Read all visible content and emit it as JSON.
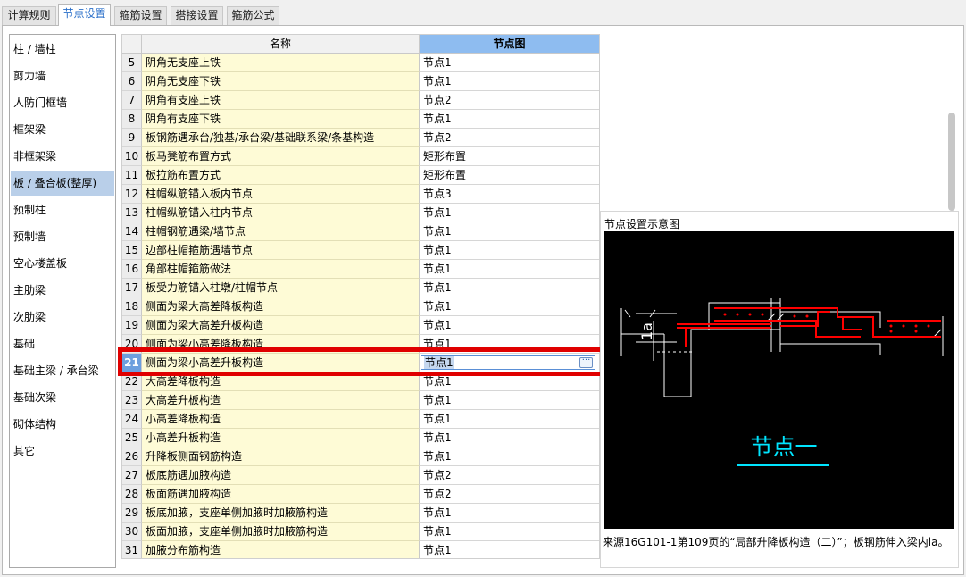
{
  "tabs": [
    {
      "label": "计算规则"
    },
    {
      "label": "节点设置"
    },
    {
      "label": "箍筋设置"
    },
    {
      "label": "搭接设置"
    },
    {
      "label": "箍筋公式"
    }
  ],
  "sidebar": {
    "items": [
      {
        "label": "柱 / 墙柱"
      },
      {
        "label": "剪力墙"
      },
      {
        "label": "人防门框墙"
      },
      {
        "label": "框架梁"
      },
      {
        "label": "非框架梁"
      },
      {
        "label": "板 / 叠合板(整厚)"
      },
      {
        "label": "预制柱"
      },
      {
        "label": "预制墙"
      },
      {
        "label": "空心楼盖板"
      },
      {
        "label": "主肋梁"
      },
      {
        "label": "次肋梁"
      },
      {
        "label": "基础"
      },
      {
        "label": "基础主梁 / 承台梁"
      },
      {
        "label": "基础次梁"
      },
      {
        "label": "砌体结构"
      },
      {
        "label": "其它"
      }
    ]
  },
  "grid": {
    "headers": {
      "name": "名称",
      "value": "节点图"
    },
    "rows": [
      {
        "num": "5",
        "name": "阴角无支座上铁",
        "value": "节点1"
      },
      {
        "num": "6",
        "name": "阴角无支座下铁",
        "value": "节点1"
      },
      {
        "num": "7",
        "name": "阴角有支座上铁",
        "value": "节点2"
      },
      {
        "num": "8",
        "name": "阴角有支座下铁",
        "value": "节点1"
      },
      {
        "num": "9",
        "name": "板钢筋遇承台/独基/承台梁/基础联系梁/条基构造",
        "value": "节点2"
      },
      {
        "num": "10",
        "name": "板马凳筋布置方式",
        "value": "矩形布置"
      },
      {
        "num": "11",
        "name": "板拉筋布置方式",
        "value": "矩形布置"
      },
      {
        "num": "12",
        "name": "柱帽纵筋锚入板内节点",
        "value": "节点3"
      },
      {
        "num": "13",
        "name": "柱帽纵筋锚入柱内节点",
        "value": "节点1"
      },
      {
        "num": "14",
        "name": "柱帽钢筋遇梁/墙节点",
        "value": "节点1"
      },
      {
        "num": "15",
        "name": "边部柱帽箍筋遇墙节点",
        "value": "节点1"
      },
      {
        "num": "16",
        "name": "角部柱帽箍筋做法",
        "value": "节点1"
      },
      {
        "num": "17",
        "name": "板受力筋锚入柱墩/柱帽节点",
        "value": "节点1"
      },
      {
        "num": "18",
        "name": "侧面为梁大高差降板构造",
        "value": "节点1"
      },
      {
        "num": "19",
        "name": "侧面为梁大高差升板构造",
        "value": "节点1"
      },
      {
        "num": "20",
        "name": "侧面为梁小高差降板构造",
        "value": "节点1"
      },
      {
        "num": "21",
        "name": "侧面为梁小高差升板构造",
        "value": "节点1"
      },
      {
        "num": "22",
        "name": "大高差降板构造",
        "value": "节点1"
      },
      {
        "num": "23",
        "name": "大高差升板构造",
        "value": "节点1"
      },
      {
        "num": "24",
        "name": "小高差降板构造",
        "value": "节点1"
      },
      {
        "num": "25",
        "name": "小高差升板构造",
        "value": "节点1"
      },
      {
        "num": "26",
        "name": "升降板侧面钢筋构造",
        "value": "节点1"
      },
      {
        "num": "27",
        "name": "板底筋遇加腋构造",
        "value": "节点2"
      },
      {
        "num": "28",
        "name": "板面筋遇加腋构造",
        "value": "节点2"
      },
      {
        "num": "29",
        "name": "板底加腋，支座单侧加腋时加腋筋构造",
        "value": "节点1"
      },
      {
        "num": "30",
        "name": "板面加腋，支座单侧加腋时加腋筋构造",
        "value": "节点1"
      },
      {
        "num": "31",
        "name": "加腋分布筋构造",
        "value": "节点1"
      }
    ],
    "ellipsis": "···"
  },
  "diagram": {
    "title": "节点设置示意图",
    "node_label": "节点一",
    "dim_label": "1a",
    "caption": "来源16G101-1第109页的“局部升降板构造（二）”；板钢筋伸入梁内la。"
  },
  "colors": {
    "tab_active": "#2a6fc9",
    "row_name_bg": "#fefbd6",
    "header_selected": "#8ebcf0",
    "row_selected_num": "#6d9fde",
    "highlight_box": "#e00000",
    "diagram_bg": "#000000",
    "rebar": "#ff0000",
    "node_label": "#00e5ff"
  }
}
